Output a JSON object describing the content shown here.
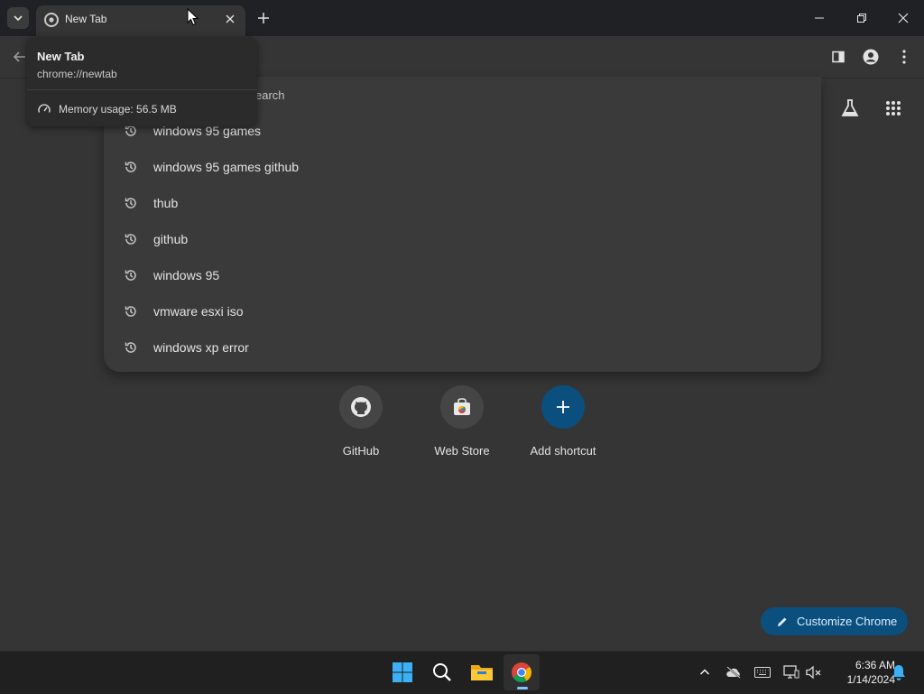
{
  "tab": {
    "title": "New Tab",
    "favicon": "chrome-icon"
  },
  "hover_card": {
    "title": "New Tab",
    "url": "chrome://newtab",
    "memory": "Memory usage: 56.5 MB"
  },
  "omnibox": {
    "hint_partial": "earch",
    "suggestions": [
      "windows 95 games",
      "windows 95 games github",
      "thub",
      "github",
      "windows 95",
      "vmware esxi iso",
      "windows xp error"
    ]
  },
  "shortcuts": [
    {
      "label": "GitHub",
      "icon": "github-icon"
    },
    {
      "label": "Web Store",
      "icon": "web-store-icon"
    },
    {
      "label": "Add shortcut",
      "icon": "plus-icon"
    }
  ],
  "customize": {
    "label": "Customize Chrome"
  },
  "clock": {
    "time": "6:36 AM",
    "date": "1/14/2024"
  },
  "colors": {
    "background": "#353535",
    "tabstrip": "#202124",
    "accent_button": "#0b4f7e",
    "add_shortcut": "#0b4f7e"
  }
}
